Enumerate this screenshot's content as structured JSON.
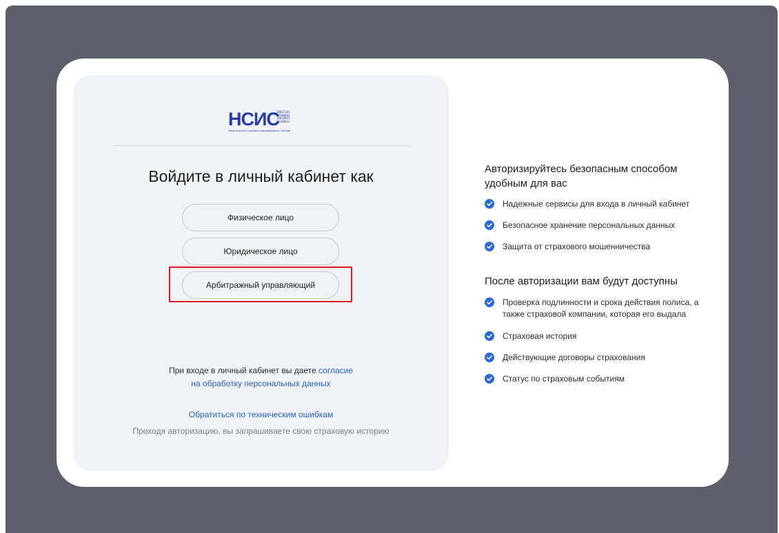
{
  "logo": {
    "main": "НСИС",
    "bits": [
      "10011101",
      "10100001",
      "10010001",
      "10100011"
    ],
    "subtitle": "Национальная Страховая Информационная Система"
  },
  "login": {
    "heading": "Войдите в личный кабинет как",
    "roles": [
      {
        "label": "Физическое лицо"
      },
      {
        "label": "Юридическое лицо"
      },
      {
        "label": "Арбитражный управляющий"
      }
    ],
    "consent_text": "При входе в личный кабинет вы даете ",
    "consent_link_1": "согласие",
    "consent_link_2": "на обработку персональных данных",
    "tech_link": "Обратиться по техническим ошибкам",
    "history_note": "Проходя авторизацию, вы запрашиваете свою страховую историю"
  },
  "info": {
    "title_1": "Авторизируйтесь безопасным способом удобным для вас",
    "features_1": [
      "Надежные сервисы для входа в личный кабинет",
      "Безопасное хранение персональных данных",
      "Защита от страхового мошенничества"
    ],
    "title_2": "После авторизации вам будут доступны",
    "features_2": [
      "Проверка подлинности и срока действия полиса, а также страховой компании, которая его выдала",
      "Страховая история",
      "Действующие договоры страхования",
      "Статус по страховым событиям"
    ]
  },
  "colors": {
    "accent": "#2a6ad1",
    "highlight": "#e11b22",
    "backdrop": "#5c606a"
  },
  "icons": {
    "check": "check-circle-icon"
  }
}
